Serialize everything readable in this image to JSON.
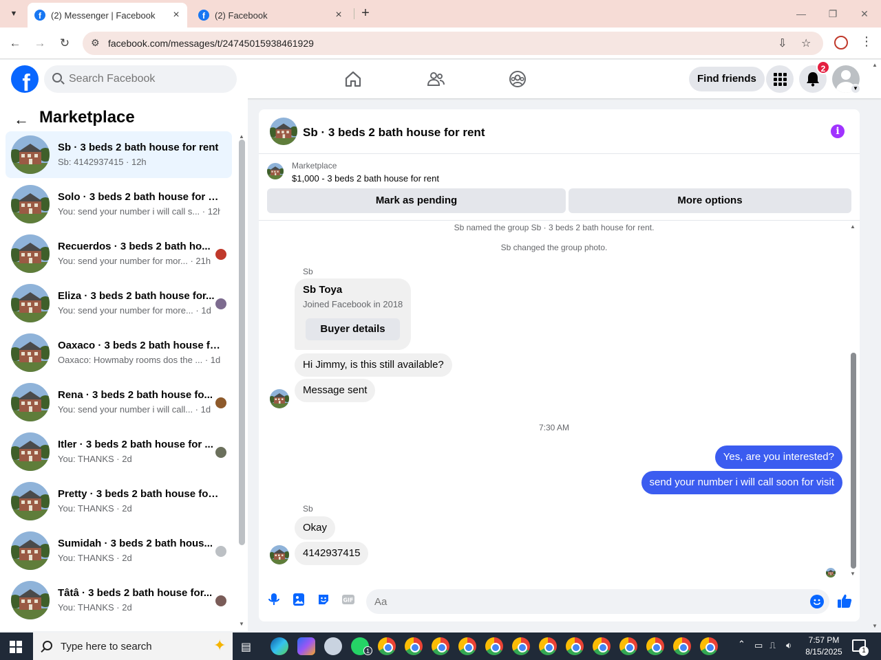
{
  "browser": {
    "tabs": [
      {
        "title": "(2) Messenger | Facebook",
        "active": true
      },
      {
        "title": "(2) Facebook",
        "active": false
      }
    ],
    "url": "facebook.com/messages/t/24745015938461929"
  },
  "fb_header": {
    "search_placeholder": "Search Facebook",
    "find_friends_label": "Find friends",
    "notification_count": "2",
    "nav_icons": [
      "home-icon",
      "friends-icon",
      "groups-icon"
    ]
  },
  "left_panel": {
    "title": "Marketplace",
    "conversations": [
      {
        "name": "Sb · 3 beds 2 bath house for rent",
        "preview": "Sb: 4142937415 · 12h",
        "active": true
      },
      {
        "name": "Solo · 3 beds 2 bath house for re...",
        "preview": "You: send your number i will call s... · 12h"
      },
      {
        "name": "Recuerdos · 3 beds 2 bath ho...",
        "preview": "You: send your number for mor... · 21h"
      },
      {
        "name": "Eliza · 3 beds 2 bath house for...",
        "preview": "You: send your number for more... · 1d"
      },
      {
        "name": "Oaxaco · 3 beds 2 bath house fo...",
        "preview": "Oaxaco: Howmaby rooms dos the ...  · 1d"
      },
      {
        "name": "Rena · 3 beds 2 bath house fo...",
        "preview": "You: send your number i will call... · 1d"
      },
      {
        "name": "Itler · 3 beds 2 bath house for ...",
        "preview": "You: THANKS · 2d"
      },
      {
        "name": "Pretty · 3 beds 2 bath house for ...",
        "preview": "You: THANKS · 2d"
      },
      {
        "name": "Sumidah · 3 beds 2 bath hous...",
        "preview": "You: THANKS · 2d"
      },
      {
        "name": "Tâtâ · 3 beds 2 bath house for...",
        "preview": "You: THANKS · 2d"
      }
    ]
  },
  "chat": {
    "title": "Sb · 3 beds 2 bath house for rent",
    "listing_label": "Marketplace",
    "listing_desc": "$1,000 - 3 beds 2 bath house for rent",
    "mark_pending_label": "Mark as pending",
    "more_options_label": "More options",
    "system_messages": [
      "Sb named the group Sb · 3 beds 2 bath house for rent.",
      "Sb changed the group photo."
    ],
    "sender_name": "Sb",
    "card": {
      "name": "Sb Toya",
      "sub": "Joined Facebook in 2018",
      "button": "Buyer details"
    },
    "messages_in_1": [
      "Hi Jimmy, is this still available?",
      "Message sent"
    ],
    "timestamp": "7:30 AM",
    "messages_out": [
      "Yes, are you interested?",
      "send your number i will call soon for visit"
    ],
    "messages_in_2": [
      "Okay",
      "4142937415"
    ],
    "composer_placeholder": "Aa"
  },
  "taskbar": {
    "search_placeholder": "Type here to search",
    "clock_time": "7:57 PM",
    "clock_date": "8/15/2025",
    "notification_count": "1",
    "whatsapp_count": "1"
  },
  "colors": {
    "fb_blue": "#0866ff",
    "outgoing_bubble": "#3b5cf0",
    "info_purple": "#a033ff",
    "badge_red": "#e41e3f"
  }
}
